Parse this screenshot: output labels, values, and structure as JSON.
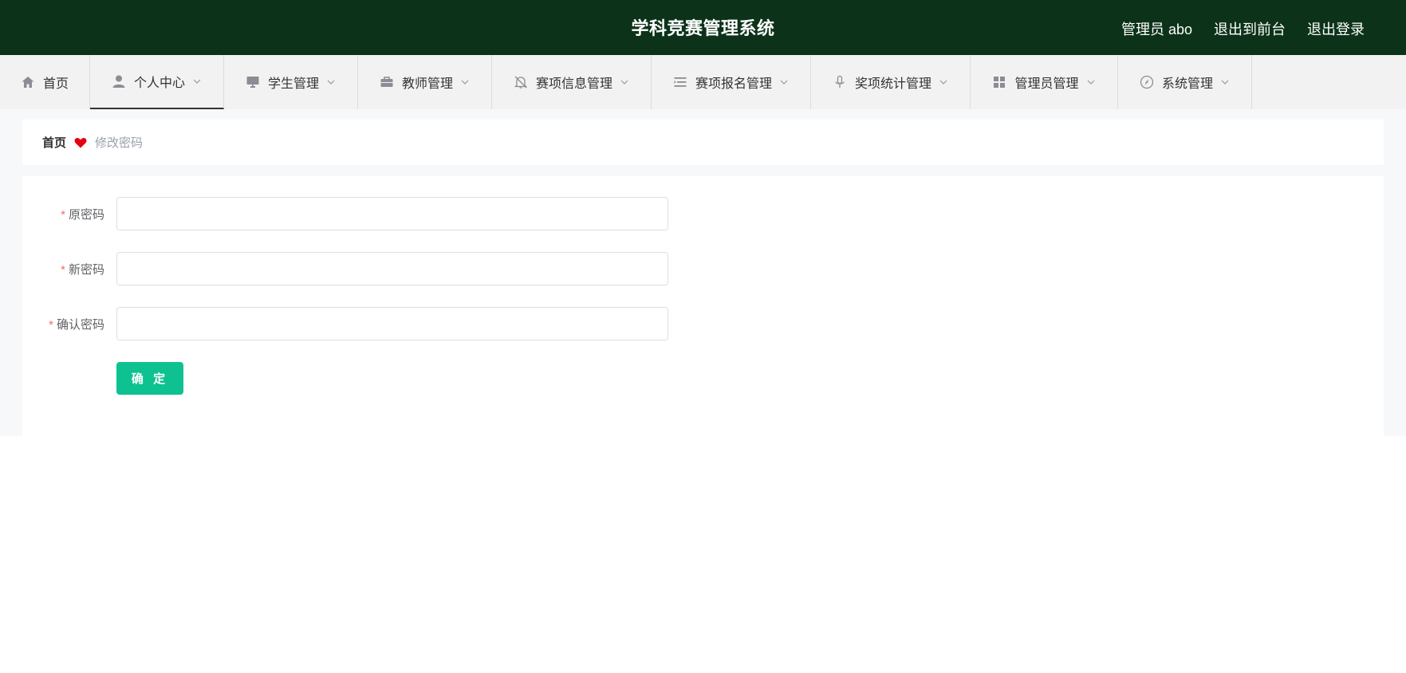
{
  "header": {
    "title": "学科竞赛管理系统",
    "user_label": "管理员 abo",
    "front_label": "退出到前台",
    "logout_label": "退出登录",
    "background_color": "#0c331a"
  },
  "nav": {
    "items": [
      {
        "label": "首页",
        "icon": "home-icon",
        "has_dropdown": false
      },
      {
        "label": "个人中心",
        "icon": "user-icon",
        "has_dropdown": true,
        "active": true
      },
      {
        "label": "学生管理",
        "icon": "monitor-icon",
        "has_dropdown": true
      },
      {
        "label": "教师管理",
        "icon": "briefcase-icon",
        "has_dropdown": true
      },
      {
        "label": "赛项信息管理",
        "icon": "bell-off-icon",
        "has_dropdown": true
      },
      {
        "label": "赛项报名管理",
        "icon": "list-icon",
        "has_dropdown": true
      },
      {
        "label": "奖项统计管理",
        "icon": "microphone-icon",
        "has_dropdown": true
      },
      {
        "label": "管理员管理",
        "icon": "grid-icon",
        "has_dropdown": true
      },
      {
        "label": "系统管理",
        "icon": "compass-icon",
        "has_dropdown": true
      }
    ]
  },
  "breadcrumb": {
    "home": "首页",
    "separator_icon": "heart-icon",
    "current": "修改密码"
  },
  "form": {
    "required_mark": "*",
    "fields": [
      {
        "label": "原密码",
        "value": "",
        "placeholder": ""
      },
      {
        "label": "新密码",
        "value": "",
        "placeholder": ""
      },
      {
        "label": "确认密码",
        "value": "",
        "placeholder": ""
      }
    ],
    "submit_label": "确 定",
    "submit_color": "#0dc290"
  }
}
